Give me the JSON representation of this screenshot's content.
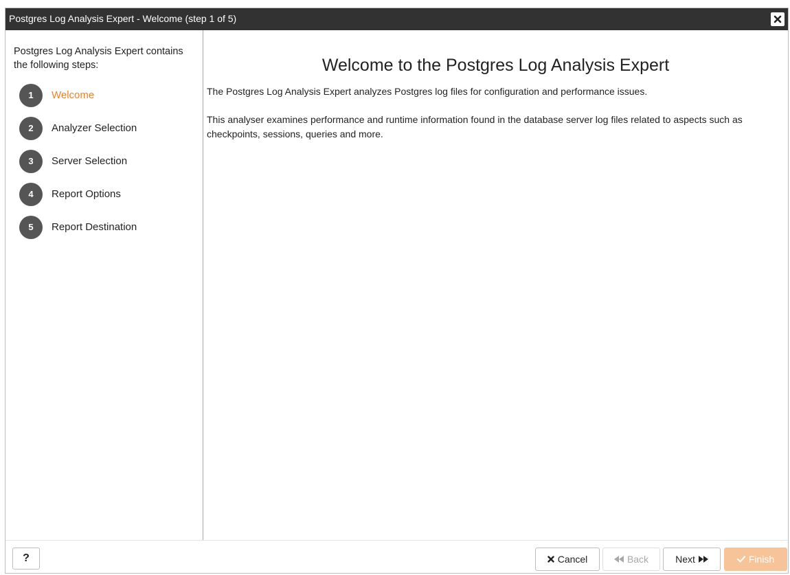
{
  "dialog": {
    "title": "Postgres Log Analysis Expert - Welcome (step 1 of 5)"
  },
  "sidebar": {
    "heading": "Postgres Log Analysis Expert contains the following steps:",
    "steps": [
      {
        "number": "1",
        "label": "Welcome",
        "active": true
      },
      {
        "number": "2",
        "label": "Analyzer Selection",
        "active": false
      },
      {
        "number": "3",
        "label": "Server Selection",
        "active": false
      },
      {
        "number": "4",
        "label": "Report Options",
        "active": false
      },
      {
        "number": "5",
        "label": "Report Destination",
        "active": false
      }
    ]
  },
  "content": {
    "title": "Welcome to the Postgres Log Analysis Expert",
    "paragraph1": "The Postgres Log Analysis Expert analyzes Postgres log files for configuration and performance issues.",
    "paragraph2": "This analyser examines performance and runtime information found in the database server log files related to aspects such as checkpoints, sessions, queries and more."
  },
  "footer": {
    "help_label": "?",
    "cancel_label": "Cancel",
    "back_label": "Back",
    "next_label": "Next",
    "finish_label": "Finish"
  },
  "colors": {
    "titlebar_bg": "#323232",
    "accent": "#f0812c",
    "step_circle": "#555555",
    "finish_disabled_bg": "#f7c49a"
  },
  "icons": {
    "close": "close-icon",
    "cancel": "times-icon",
    "back": "fast-backward-icon",
    "next": "fast-forward-icon",
    "finish": "check-icon"
  }
}
